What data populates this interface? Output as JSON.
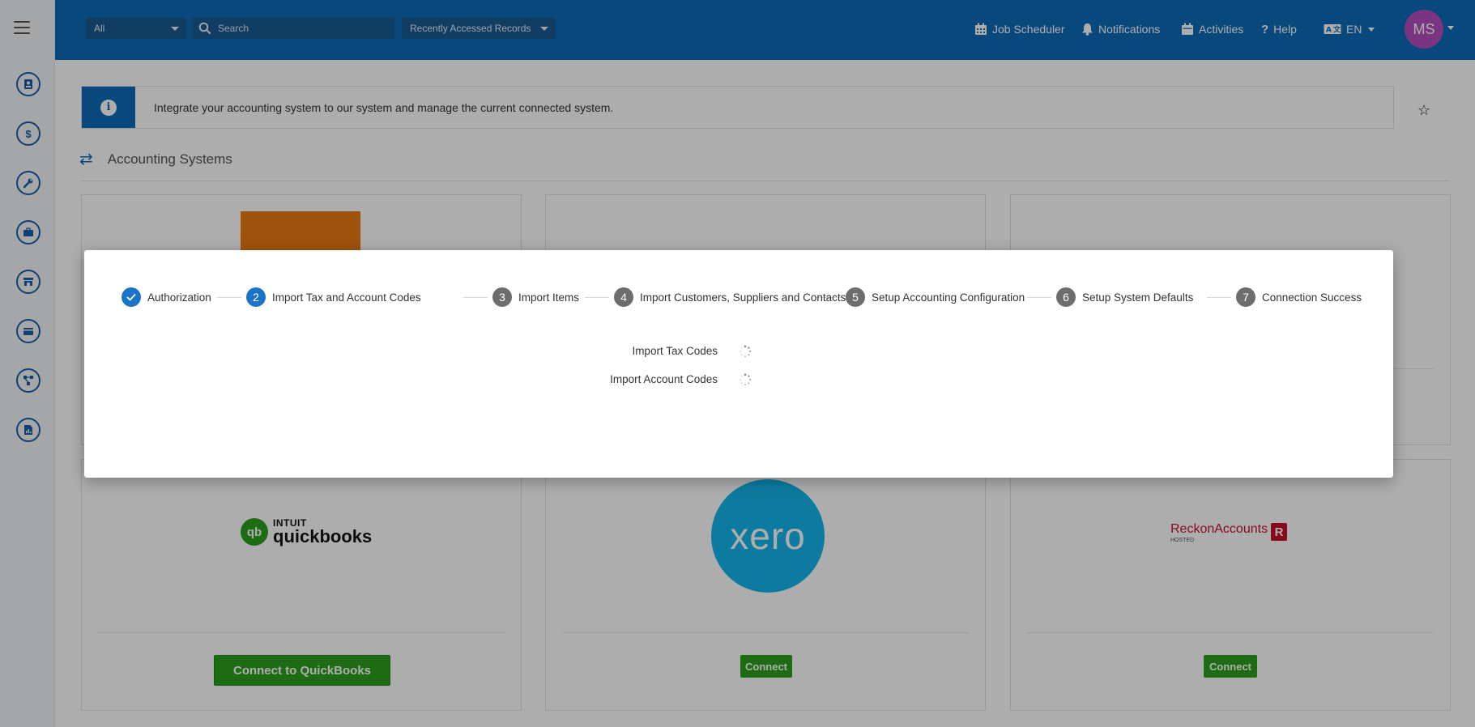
{
  "topbar": {
    "scope_select": "All",
    "search_placeholder": "Search",
    "recent_select": "Recently Accessed Records",
    "job_scheduler": "Job Scheduler",
    "notifications": "Notifications",
    "activities": "Activities",
    "help": "Help",
    "language": "EN",
    "avatar_initials": "MS"
  },
  "sidebar": {
    "icons": [
      "contacts-icon",
      "dollar-icon",
      "wrench-icon",
      "briefcase-icon",
      "store-icon",
      "wallet-icon",
      "workflow-icon",
      "report-icon"
    ]
  },
  "info": {
    "text": "Integrate your accounting system to our system and manage the current connected system."
  },
  "section": {
    "title": "Accounting Systems"
  },
  "cards": {
    "quickbooks": {
      "intuit": "INTUIT",
      "name": "quickbooks",
      "button": "Connect to QuickBooks"
    },
    "xero": {
      "name": "xero",
      "button": "Connect"
    },
    "reckon": {
      "name_a": "Reckon",
      "name_b": "Accounts",
      "hosted": "HOSTED",
      "badge": "R",
      "button": "Connect"
    }
  },
  "wizard": {
    "steps": [
      {
        "number": "✓",
        "label": "Authorization",
        "state": "done"
      },
      {
        "number": "2",
        "label": "Import Tax and Account Codes",
        "state": "active"
      },
      {
        "number": "3",
        "label": "Import Items",
        "state": "pending"
      },
      {
        "number": "4",
        "label": "Import Customers, Suppliers and Contacts",
        "state": "pending"
      },
      {
        "number": "5",
        "label": "Setup Accounting Configuration",
        "state": "pending"
      },
      {
        "number": "6",
        "label": "Setup System Defaults",
        "state": "pending"
      },
      {
        "number": "7",
        "label": "Connection Success",
        "state": "pending"
      }
    ],
    "imports": [
      {
        "label": "Import Tax Codes"
      },
      {
        "label": "Import Account Codes"
      }
    ]
  },
  "colors": {
    "primary": "#0e6ab8",
    "step_active": "#1b74c9",
    "step_pending": "#6d6d6d",
    "success_green": "#2ca01c",
    "xero_blue": "#13b5ea",
    "reckon_red": "#c8102e",
    "avatar": "#b44fc0"
  }
}
